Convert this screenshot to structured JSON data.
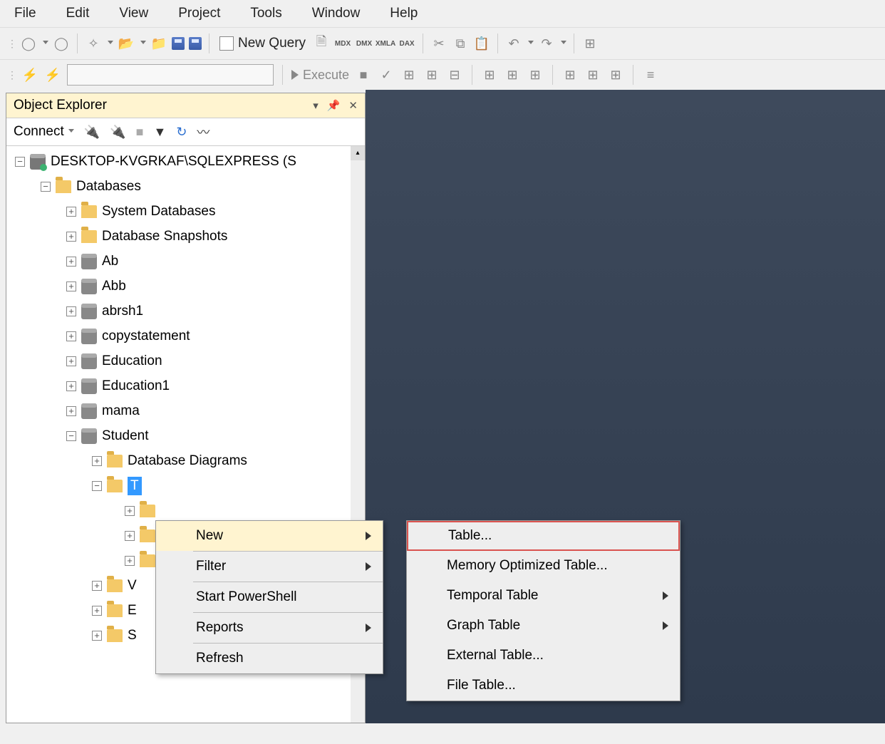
{
  "menubar": [
    "File",
    "Edit",
    "View",
    "Project",
    "Tools",
    "Window",
    "Help"
  ],
  "toolbar": {
    "new_query": "New Query",
    "execute": "Execute",
    "mdx": "MDX",
    "dmx": "DMX",
    "xmla": "XMLA",
    "dax": "DAX"
  },
  "object_explorer": {
    "title": "Object Explorer",
    "connect": "Connect"
  },
  "tree": {
    "server": "DESKTOP-KVGRKAF\\SQLEXPRESS (S",
    "databases": "Databases",
    "sysdb": "System Databases",
    "snapshots": "Database Snapshots",
    "dbs": [
      "Ab",
      "Abb",
      "abrsh1",
      "copystatement",
      "Education",
      "Education1",
      "mama",
      "Student"
    ],
    "student_children": {
      "diagrams": "Database Diagrams",
      "tables": "T"
    },
    "partial": [
      "V",
      "E",
      "S"
    ]
  },
  "context": {
    "new": "New",
    "filter": "Filter",
    "powershell": "Start PowerShell",
    "reports": "Reports",
    "refresh": "Refresh"
  },
  "submenu": {
    "table": "Table...",
    "mem": "Memory Optimized Table...",
    "temporal": "Temporal Table",
    "graph": "Graph Table",
    "external": "External Table...",
    "file": "File Table..."
  }
}
